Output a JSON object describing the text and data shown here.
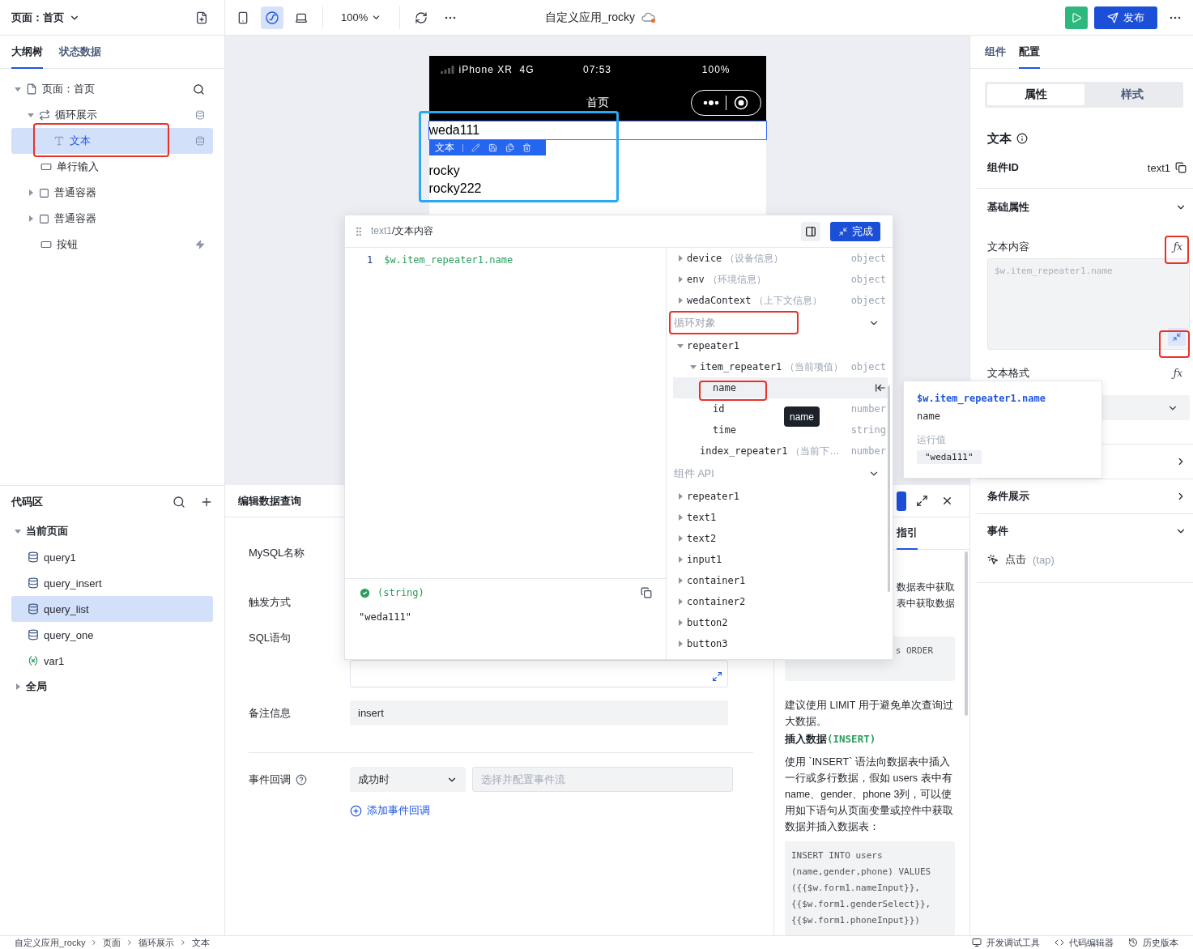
{
  "top_bar": {
    "page_selector": "页面：首页",
    "devices": [
      {
        "kind": "phone",
        "selected": false
      },
      {
        "kind": "miniprogram",
        "selected": true
      },
      {
        "kind": "desktop",
        "selected": false
      }
    ],
    "zoom": "100%",
    "app_title": "自定义应用_rocky",
    "publish_button": "发布"
  },
  "outline": {
    "tabs": [
      {
        "label": "大纲树",
        "selected": true
      },
      {
        "label": "状态数据",
        "selected": false
      }
    ],
    "tree": [
      {
        "label": "页面：首页",
        "kind": "page",
        "expanded": true,
        "selected": false,
        "children": [
          {
            "label": "循环展示",
            "kind": "repeater",
            "expanded": true,
            "selected": false,
            "children": [
              {
                "label": "文本",
                "kind": "text",
                "selected": true
              }
            ]
          },
          {
            "label": "单行输入",
            "kind": "input",
            "selected": false
          },
          {
            "label": "普通容器",
            "kind": "container",
            "expanded": false,
            "selected": false
          },
          {
            "label": "普通容器",
            "kind": "container",
            "expanded": false,
            "selected": false
          },
          {
            "label": "按钮",
            "kind": "button",
            "selected": false
          }
        ]
      }
    ]
  },
  "code_area": {
    "title": "代码区",
    "tree": [
      {
        "label": "当前页面",
        "expanded": true,
        "children": [
          {
            "label": "query1",
            "kind": "query",
            "selected": false
          },
          {
            "label": "query_insert",
            "kind": "query",
            "selected": false
          },
          {
            "label": "query_list",
            "kind": "query",
            "selected": true
          },
          {
            "label": "query_one",
            "kind": "query",
            "selected": false
          },
          {
            "label": "var1",
            "kind": "variable",
            "selected": false
          }
        ]
      },
      {
        "label": "全局",
        "expanded": false
      }
    ]
  },
  "phone": {
    "device": "iPhone XR  4G",
    "time": "07:53",
    "battery": "100%",
    "nav_title": "首页",
    "toolbar_label": "文本",
    "items": [
      {
        "text": "weda111",
        "selected": true
      },
      {
        "text": "rocky",
        "selected": false
      },
      {
        "text": "rocky222",
        "selected": false
      }
    ]
  },
  "query_editor": {
    "title": "编辑数据查询",
    "labels": [
      "MySQL名称",
      "触发方式",
      "SQL语句"
    ],
    "remark": {
      "label": "备注信息",
      "value": "insert"
    },
    "callback": {
      "label": "事件回调",
      "select": "成功时",
      "placeholder": "选择并配置事件流",
      "add_link": "添加事件回调"
    },
    "guide": {
      "tab": "指引",
      "lines": [
        "数据表中获取",
        "表中获取数据"
      ],
      "code_fragment": "s ORDER",
      "tip": "建议使用 LIMIT 用于避免单次查询过大数据。",
      "insert_title": "插入数据",
      "insert_keyword": "(INSERT)",
      "insert_text": "使用 `INSERT` 语法向数据表中插入一行或多行数据，假如 users 表中有 name、gender、phone 3列，可以使用如下语句从页面变量或控件中获取数据并插入数据表：",
      "insert_code": [
        "INSERT INTO users",
        "(name,gender,phone) VALUES",
        "({{$w.form1.nameInput}},",
        "{{$w.form1.genderSelect}},",
        "{{$w.form1.phoneInput}})"
      ]
    }
  },
  "expression_editor": {
    "path_prefix": "text1",
    "path_rest": "/文本内容",
    "done_button": "完成",
    "code_lines": [
      {
        "number": "1",
        "code": "$w.item_repeater1.name"
      }
    ],
    "result_type": "(string)",
    "result_value": "\"weda111\"",
    "variables": [
      {
        "name": "device",
        "note": "（设备信息）",
        "type": "object",
        "expanded": false
      },
      {
        "name": "env",
        "note": "（环境信息）",
        "type": "object",
        "expanded": false
      },
      {
        "name": "wedaContext",
        "note": "（上下文信息）",
        "type": "object",
        "expanded": false
      }
    ],
    "sections": [
      {
        "title": "循环对象",
        "expanded": true,
        "items": [
          {
            "name": "repeater1",
            "expanded": true,
            "children": [
              {
                "name": "item_repeater1",
                "note": "（当前项值）",
                "type": "object",
                "expanded": true,
                "children": [
                  {
                    "name": "name",
                    "selected": true
                  },
                  {
                    "name": "id",
                    "type": "number",
                    "selected": false
                  },
                  {
                    "name": "time",
                    "type": "string",
                    "selected": false
                  }
                ]
              },
              {
                "name": "index_repeater1",
                "note": "（当前下…",
                "type": "number"
              }
            ]
          }
        ]
      },
      {
        "title": "组件 API",
        "expanded": true,
        "items": [
          {
            "name": "repeater1",
            "expanded": false
          },
          {
            "name": "text1",
            "expanded": false
          },
          {
            "name": "text2",
            "expanded": false
          },
          {
            "name": "input1",
            "expanded": false
          },
          {
            "name": "container1",
            "expanded": false
          },
          {
            "name": "container2",
            "expanded": false
          },
          {
            "name": "button2",
            "expanded": false
          },
          {
            "name": "button3",
            "expanded": false
          }
        ]
      }
    ],
    "hover_tooltip": "name"
  },
  "value_popover": {
    "expression": "$w.item_repeater1.name",
    "name": "name",
    "value_label": "运行值",
    "value": "\"weda111\""
  },
  "right_panel": {
    "tabs": [
      {
        "label": "组件",
        "selected": false
      },
      {
        "label": "配置",
        "selected": true
      }
    ],
    "segments": [
      {
        "label": "属性",
        "selected": true
      },
      {
        "label": "样式",
        "selected": false
      }
    ],
    "component_title": "文本",
    "id_label": "组件ID",
    "id_value": "text1",
    "sections": [
      {
        "kind": "basic",
        "title": "基础属性",
        "expanded": true
      },
      {
        "kind": "hidden",
        "expanded": false
      },
      {
        "kind": "plain",
        "title": "条件展示",
        "expanded": false
      },
      {
        "kind": "events",
        "title": "事件",
        "expanded": true
      }
    ],
    "content_label": "文本内容",
    "content_fx": "ƒx",
    "format_fx": "ƒx",
    "content_placeholder": "$w.item_repeater1.name",
    "format_label": "文本格式",
    "event": {
      "label": "点击",
      "trigger": "(tap)"
    }
  },
  "status_bar": {
    "breadcrumbs": [
      "自定义应用_rocky",
      "页面",
      "循环展示",
      "文本"
    ],
    "tools": [
      {
        "kind": "debug",
        "label": "开发调试工具"
      },
      {
        "kind": "code",
        "label": "代码编辑器"
      },
      {
        "kind": "history",
        "label": "历史版本"
      }
    ]
  }
}
